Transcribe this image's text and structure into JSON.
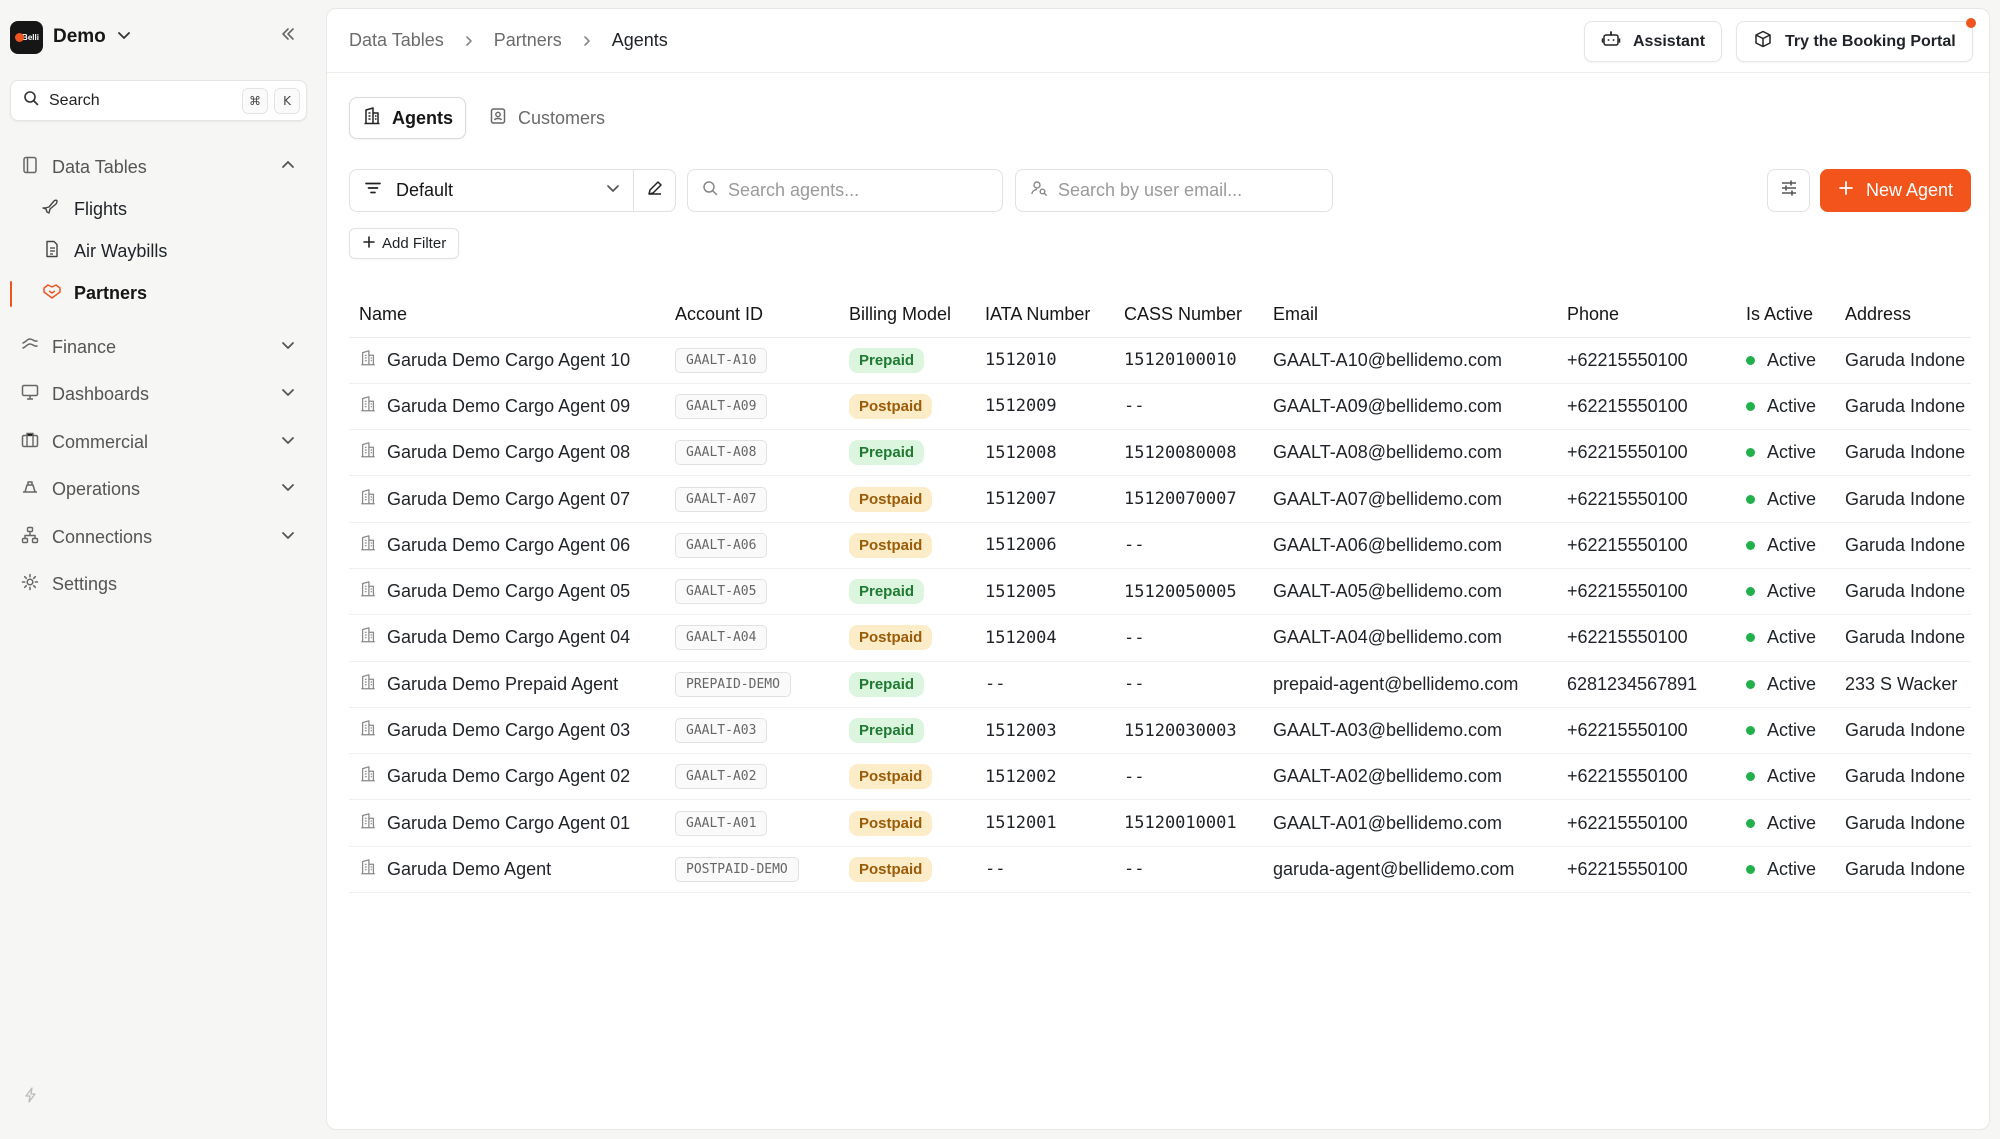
{
  "sidebar": {
    "workspace_name": "Demo",
    "logo_text": "Belli",
    "search_label": "Search",
    "search_kbd": [
      "⌘",
      "K"
    ],
    "data_tables_label": "Data Tables",
    "sub_items": [
      {
        "label": "Flights"
      },
      {
        "label": "Air Waybills"
      },
      {
        "label": "Partners"
      }
    ],
    "groups": [
      {
        "label": "Finance"
      },
      {
        "label": "Dashboards"
      },
      {
        "label": "Commercial"
      },
      {
        "label": "Operations"
      },
      {
        "label": "Connections"
      }
    ],
    "settings_label": "Settings"
  },
  "header": {
    "breadcrumbs": [
      "Data Tables",
      "Partners",
      "Agents"
    ],
    "assistant_label": "Assistant",
    "portal_label": "Try the Booking Portal"
  },
  "tabs": [
    {
      "label": "Agents"
    },
    {
      "label": "Customers"
    }
  ],
  "toolbar": {
    "view_label": "Default",
    "search_agents_placeholder": "Search agents...",
    "search_email_placeholder": "Search by user email...",
    "new_agent_label": "New Agent",
    "add_filter_label": "Add Filter"
  },
  "colors": {
    "accent": "#f2541b",
    "prepaid_bg": "#dcf5df",
    "postpaid_bg": "#fdecc8",
    "active_dot": "#22b04b"
  },
  "table": {
    "columns": [
      "Name",
      "Account ID",
      "Billing Model",
      "IATA Number",
      "CASS Number",
      "Email",
      "Phone",
      "Is Active",
      "Address"
    ],
    "rows": [
      {
        "name": "Garuda Demo Cargo Agent 10",
        "account_id": "GAALT-A10",
        "billing": "Prepaid",
        "iata": "1512010",
        "cass": "15120100010",
        "email": "GAALT-A10@bellidemo.com",
        "phone": "+62215550100",
        "active": "Active",
        "address": "Garuda Indone"
      },
      {
        "name": "Garuda Demo Cargo Agent 09",
        "account_id": "GAALT-A09",
        "billing": "Postpaid",
        "iata": "1512009",
        "cass": "--",
        "email": "GAALT-A09@bellidemo.com",
        "phone": "+62215550100",
        "active": "Active",
        "address": "Garuda Indone"
      },
      {
        "name": "Garuda Demo Cargo Agent 08",
        "account_id": "GAALT-A08",
        "billing": "Prepaid",
        "iata": "1512008",
        "cass": "15120080008",
        "email": "GAALT-A08@bellidemo.com",
        "phone": "+62215550100",
        "active": "Active",
        "address": "Garuda Indone"
      },
      {
        "name": "Garuda Demo Cargo Agent 07",
        "account_id": "GAALT-A07",
        "billing": "Postpaid",
        "iata": "1512007",
        "cass": "15120070007",
        "email": "GAALT-A07@bellidemo.com",
        "phone": "+62215550100",
        "active": "Active",
        "address": "Garuda Indone"
      },
      {
        "name": "Garuda Demo Cargo Agent 06",
        "account_id": "GAALT-A06",
        "billing": "Postpaid",
        "iata": "1512006",
        "cass": "--",
        "email": "GAALT-A06@bellidemo.com",
        "phone": "+62215550100",
        "active": "Active",
        "address": "Garuda Indone"
      },
      {
        "name": "Garuda Demo Cargo Agent 05",
        "account_id": "GAALT-A05",
        "billing": "Prepaid",
        "iata": "1512005",
        "cass": "15120050005",
        "email": "GAALT-A05@bellidemo.com",
        "phone": "+62215550100",
        "active": "Active",
        "address": "Garuda Indone"
      },
      {
        "name": "Garuda Demo Cargo Agent 04",
        "account_id": "GAALT-A04",
        "billing": "Postpaid",
        "iata": "1512004",
        "cass": "--",
        "email": "GAALT-A04@bellidemo.com",
        "phone": "+62215550100",
        "active": "Active",
        "address": "Garuda Indone"
      },
      {
        "name": "Garuda Demo Prepaid Agent",
        "account_id": "PREPAID-DEMO",
        "billing": "Prepaid",
        "iata": "--",
        "cass": "--",
        "email": "prepaid-agent@bellidemo.com",
        "phone": "6281234567891",
        "active": "Active",
        "address": "233 S Wacker"
      },
      {
        "name": "Garuda Demo Cargo Agent 03",
        "account_id": "GAALT-A03",
        "billing": "Prepaid",
        "iata": "1512003",
        "cass": "15120030003",
        "email": "GAALT-A03@bellidemo.com",
        "phone": "+62215550100",
        "active": "Active",
        "address": "Garuda Indone"
      },
      {
        "name": "Garuda Demo Cargo Agent 02",
        "account_id": "GAALT-A02",
        "billing": "Postpaid",
        "iata": "1512002",
        "cass": "--",
        "email": "GAALT-A02@bellidemo.com",
        "phone": "+62215550100",
        "active": "Active",
        "address": "Garuda Indone"
      },
      {
        "name": "Garuda Demo Cargo Agent 01",
        "account_id": "GAALT-A01",
        "billing": "Postpaid",
        "iata": "1512001",
        "cass": "15120010001",
        "email": "GAALT-A01@bellidemo.com",
        "phone": "+62215550100",
        "active": "Active",
        "address": "Garuda Indone"
      },
      {
        "name": "Garuda Demo Agent",
        "account_id": "POSTPAID-DEMO",
        "billing": "Postpaid",
        "iata": "--",
        "cass": "--",
        "email": "garuda-agent@bellidemo.com",
        "phone": "+62215550100",
        "active": "Active",
        "address": "Garuda Indone"
      }
    ]
  }
}
